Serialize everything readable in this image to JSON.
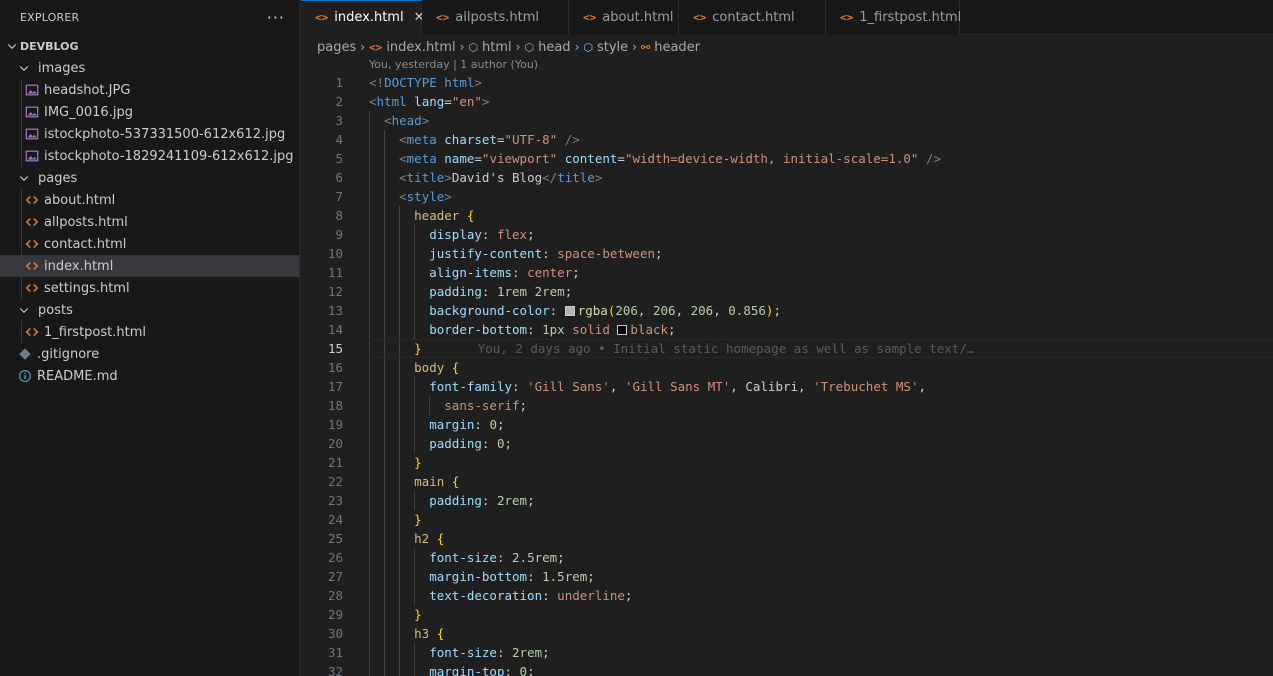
{
  "explorer": {
    "title": "EXPLORER",
    "more": "···",
    "root": "DEVBLOG",
    "items": [
      {
        "label": "images",
        "type": "folder",
        "depth": 1
      },
      {
        "label": "headshot.JPG",
        "type": "image",
        "depth": 2
      },
      {
        "label": "IMG_0016.jpg",
        "type": "image",
        "depth": 2
      },
      {
        "label": "istockphoto-537331500-612x612.jpg",
        "type": "image",
        "depth": 2
      },
      {
        "label": "istockphoto-1829241109-612x612.jpg",
        "type": "image",
        "depth": 2
      },
      {
        "label": "pages",
        "type": "folder",
        "depth": 1
      },
      {
        "label": "about.html",
        "type": "html",
        "depth": 2
      },
      {
        "label": "allposts.html",
        "type": "html",
        "depth": 2
      },
      {
        "label": "contact.html",
        "type": "html",
        "depth": 2
      },
      {
        "label": "index.html",
        "type": "html",
        "depth": 2,
        "selected": true
      },
      {
        "label": "settings.html",
        "type": "html",
        "depth": 2
      },
      {
        "label": "posts",
        "type": "folder",
        "depth": 1
      },
      {
        "label": "1_firstpost.html",
        "type": "html",
        "depth": 2
      },
      {
        "label": ".gitignore",
        "type": "git",
        "depth": 1
      },
      {
        "label": "README.md",
        "type": "info",
        "depth": 1
      }
    ]
  },
  "tabs": [
    {
      "label": "index.html",
      "active": true,
      "close": "✕"
    },
    {
      "label": "allposts.html"
    },
    {
      "label": "about.html"
    },
    {
      "label": "contact.html"
    },
    {
      "label": "1_firstpost.html"
    }
  ],
  "tab_icon": "<>",
  "breadcrumb": {
    "folder": "pages",
    "file": "index.html",
    "html": "html",
    "head": "head",
    "style": "style",
    "header": "header"
  },
  "blame_header": "You, yesterday | 1 author (You)",
  "inline_blame": "You, 2 days ago • Initial static homepage as well as sample text/…",
  "current_line": 15,
  "colors": {
    "accent": "#0078d4",
    "html_icon": "#e37933",
    "selected_row": "#37373d"
  },
  "code_lines": [
    "<!DOCTYPE html>",
    "<html lang=\"en\">",
    "  <head>",
    "    <meta charset=\"UTF-8\" />",
    "    <meta name=\"viewport\" content=\"width=device-width, initial-scale=1.0\" />",
    "    <title>David's Blog</title>",
    "    <style>",
    "      header {",
    "        display: flex;",
    "        justify-content: space-between;",
    "        align-items: center;",
    "        padding: 1rem 2rem;",
    "        background-color: rgba(206, 206, 206, 0.856);",
    "        border-bottom: 1px solid black;",
    "      }",
    "      body {",
    "        font-family: 'Gill Sans', 'Gill Sans MT', Calibri, 'Trebuchet MS',",
    "          sans-serif;",
    "        margin: 0;",
    "        padding: 0;",
    "      }",
    "      main {",
    "        padding: 2rem;",
    "      }",
    "      h2 {",
    "        font-size: 2.5rem;",
    "        margin-bottom: 1.5rem;",
    "        text-decoration: underline;",
    "      }",
    "      h3 {",
    "        font-size: 2rem;",
    "        margin-top: 0;"
  ]
}
